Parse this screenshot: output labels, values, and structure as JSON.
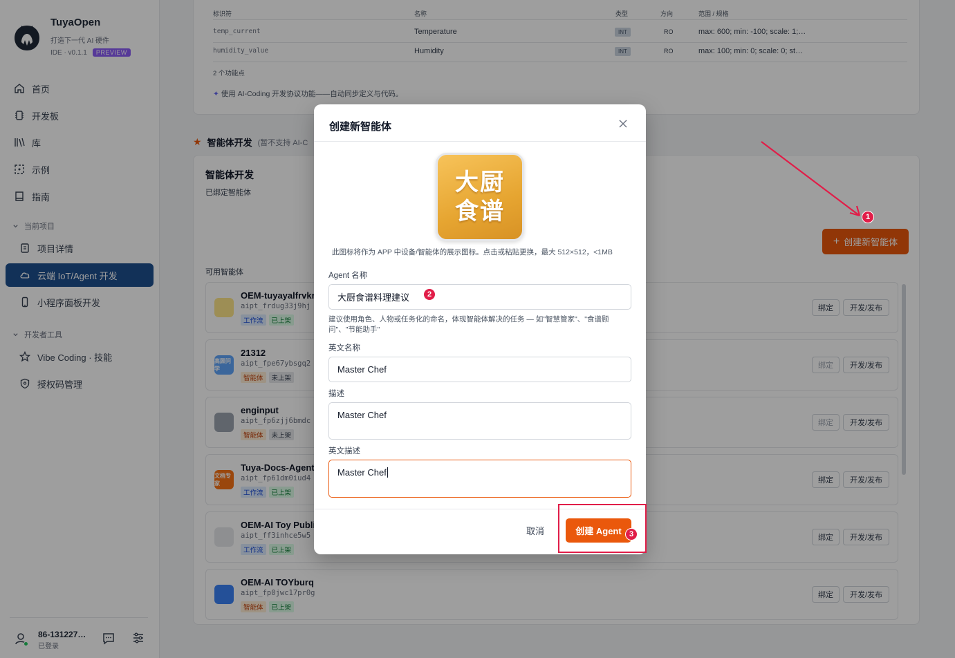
{
  "brand": {
    "title": "TuyaOpen",
    "subtitle": "打造下一代 AI 硬件",
    "version": "IDE · v0.1.1",
    "badge": "PREVIEW"
  },
  "nav": {
    "home": "首页",
    "board": "开发板",
    "library": "库",
    "examples": "示例",
    "guide": "指南",
    "section_project": "当前项目",
    "project_detail": "项目详情",
    "cloud_iot": "云端 IoT/Agent 开发",
    "miniapp": "小程序面板开发",
    "section_devtools": "开发者工具",
    "vibe_coding": "Vibe Coding · 技能",
    "license": "授权码管理"
  },
  "user": {
    "name": "86-131227…",
    "status": "已登录"
  },
  "dp_table": {
    "headers": [
      "标识符",
      "名称",
      "类型",
      "方向",
      "范围 / 规格"
    ],
    "rows": [
      {
        "id": "temp_current",
        "name": "Temperature",
        "type": "INT",
        "dir": "RO",
        "range": "max: 600; min: -100; scale: 1;…"
      },
      {
        "id": "humidity_value",
        "name": "Humidity",
        "type": "INT",
        "dir": "RO",
        "range": "max: 100; min: 0; scale: 0; st…"
      }
    ],
    "count": "2 个功能点",
    "ai_hint": "使用 AI-Coding 开发协议功能——自动同步定义与代码。"
  },
  "agent_section": {
    "title": "智能体开发",
    "note": "(暂不支持 AI-C",
    "card_title": "智能体开发",
    "bound": "已绑定智能体",
    "create": "创建新智能体",
    "available": "可用智能体",
    "bind_label": "绑定",
    "publish_label": "开发/发布",
    "agents": [
      {
        "name": "OEM-tuyayalfrvkr",
        "id": "aipt_frdug33j9hj",
        "tags": [
          "工作流",
          "已上架"
        ],
        "icon_text": "",
        "color": "#fde68a"
      },
      {
        "name": "21312",
        "id": "aipt_fpe67ybsgq2",
        "tags": [
          "智能体",
          "未上架"
        ],
        "icon_text": "高顾问学",
        "color": "#60a5fa"
      },
      {
        "name": "enginput",
        "id": "aipt_fp6zjj6bmdc",
        "tags": [
          "智能体",
          "未上架"
        ],
        "icon_text": "",
        "color": "#9ca3af"
      },
      {
        "name": "Tuya-Docs-Agent",
        "id": "aipt_fp61dm0iud4",
        "tags": [
          "工作流",
          "已上架"
        ],
        "icon_text": "文档专家",
        "color": "#f97316"
      },
      {
        "name": "OEM-AI Toy Publi",
        "id": "aipt_ff3inhce5w5",
        "tags": [
          "工作流",
          "已上架"
        ],
        "icon_text": "",
        "color": "#e5e7eb"
      },
      {
        "name": "OEM-AI TOYburq",
        "id": "aipt_fp0jwc17pr0g",
        "tags": [
          "智能体",
          "已上架"
        ],
        "icon_text": "",
        "color": "#3b82f6"
      }
    ]
  },
  "modal": {
    "title": "创建新智能体",
    "icon_line1": "大厨",
    "icon_line2": "食谱",
    "icon_hint": "此图标将作为 APP 中设备/智能体的展示图标。点击或粘贴更换，最大 512×512，<1MB",
    "name_label": "Agent 名称",
    "name_value": "大厨食谱料理建议",
    "name_hint": "建议使用角色、人物或任务化的命名，体现智能体解决的任务 — 如\"智慧管家\"、\"食谱顾问\"、\"节能助手\"",
    "en_name_label": "英文名称",
    "en_name_value": "Master Chef",
    "desc_label": "描述",
    "desc_value": "Master Chef",
    "en_desc_label": "英文描述",
    "en_desc_value": "Master Chef",
    "cancel": "取消",
    "submit": "创建 Agent"
  },
  "annotations": {
    "n1": "1",
    "n2": "2",
    "n3": "3"
  },
  "colors": {
    "accent": "#ea580c",
    "nav_active": "#1e4f8f",
    "annotation": "#e11d48"
  }
}
